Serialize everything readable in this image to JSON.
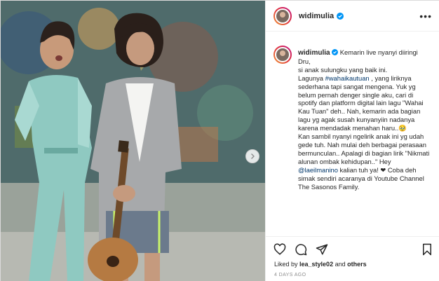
{
  "header": {
    "username": "widimulia",
    "more_icon": "more-icon"
  },
  "caption": {
    "username": "widimulia",
    "line1": "Kemarin live nyanyi diiringi Dru,",
    "line2": "si anak sulungku yang baik ini.",
    "line3_pre": "Lagunya ",
    "hashtag": "#wahaikautuan",
    "line3_post": " , yang liriknya sederhana tapi sangat mengena. Yuk yg belum pernah denger single aku, cari di spotify dan platform digital lain lagu \"Wahai Kau Tuan\" deh.. Nah, kemarin ada bagian lagu yg agak susah kunyanyiin nadanya karena mendadak menahan haru..",
    "emoji": "🥹",
    "line4_pre": "Kan sambil nyanyi ngelirik anak ini yg udah gede tuh. Nah mulai deh berbagai perasaan bermunculan.. Apalagi di bagian lirik \"Nikmati alunan ombak kehidupan..\" Hey ",
    "mention": "@laeilmanino",
    "line4_post": " kalian tuh ya! ❤ Coba deh simak sendiri acaranya di Youtube Channel The Sasonos Family."
  },
  "actions": {
    "like_icon": "heart-icon",
    "comment_icon": "comment-icon",
    "share_icon": "share-icon",
    "save_icon": "bookmark-icon"
  },
  "likes": {
    "prefix": "Liked by ",
    "user": "lea_style02",
    "middle": " and ",
    "others": "others"
  },
  "timestamp": "4 DAYS AGO",
  "colors": {
    "accent_blue": "#0095f6",
    "link": "#00376b",
    "muted": "#8e8e8e",
    "border": "#dbdbdb"
  }
}
